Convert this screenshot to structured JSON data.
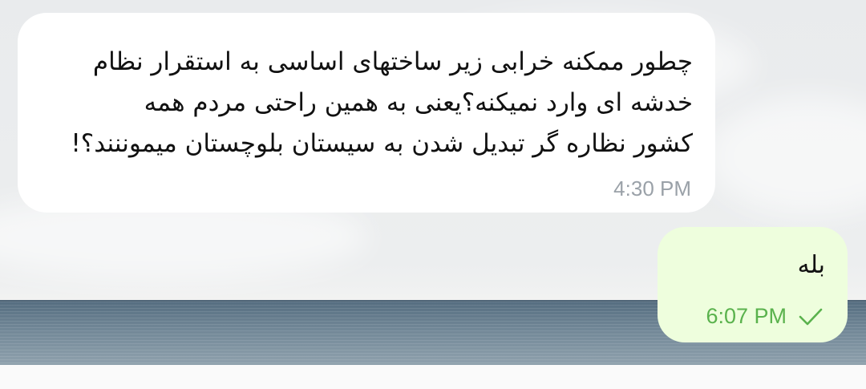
{
  "messages": {
    "incoming": {
      "text": "چطور ممکنه خرابی زیر ساختهای اساسی به استقرار نظام\nخدشه ای وارد نمیکنه؟یعنی به همین راحتی مردم همه\nکشور نظاره گر تبدیل شدن به سیستان بلوچستان میموننند؟!",
      "time": "4:30 PM"
    },
    "outgoing": {
      "text": "بله",
      "time": "6:07 PM",
      "status_icon": "single-check-icon"
    }
  },
  "colors": {
    "incoming_bubble": "#ffffff",
    "outgoing_bubble": "#eefedd",
    "incoming_time": "#9aa1a8",
    "outgoing_time": "#5ab24d"
  }
}
